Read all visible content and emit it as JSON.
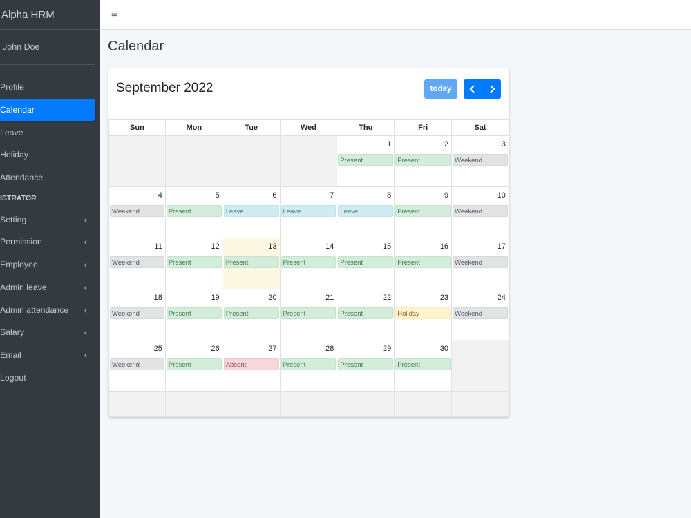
{
  "sidebar": {
    "brand": "Alpha HRM",
    "user_name": "John Doe",
    "items": [
      {
        "label": "Profile",
        "type": "item",
        "active": false,
        "arrow": false
      },
      {
        "label": "Calendar",
        "type": "item",
        "active": true,
        "arrow": false
      },
      {
        "label": "Leave",
        "type": "item",
        "active": false,
        "arrow": false
      },
      {
        "label": "Holiday",
        "type": "item",
        "active": false,
        "arrow": false
      },
      {
        "label": "Attendance",
        "type": "item",
        "active": false,
        "arrow": false
      },
      {
        "label": "ISTRATOR",
        "type": "header",
        "active": false,
        "arrow": false
      },
      {
        "label": "Setting",
        "type": "item",
        "active": false,
        "arrow": true
      },
      {
        "label": "Permission",
        "type": "item",
        "active": false,
        "arrow": true
      },
      {
        "label": "Employee",
        "type": "item",
        "active": false,
        "arrow": true
      },
      {
        "label": "Admin leave",
        "type": "item",
        "active": false,
        "arrow": true
      },
      {
        "label": "Admin attendance",
        "type": "item",
        "active": false,
        "arrow": true
      },
      {
        "label": "Salary",
        "type": "item",
        "active": false,
        "arrow": true
      },
      {
        "label": "Email",
        "type": "item",
        "active": false,
        "arrow": true
      },
      {
        "label": "Logout",
        "type": "item",
        "active": false,
        "arrow": false
      }
    ],
    "arrow_glyph": "‹"
  },
  "topbar": {
    "menu_glyph": "≡"
  },
  "page": {
    "title": "Calendar"
  },
  "calendar": {
    "title": "September 2022",
    "today_label": "today",
    "weekdays": [
      "Sun",
      "Mon",
      "Tue",
      "Wed",
      "Thu",
      "Fri",
      "Sat"
    ],
    "weeks": [
      [
        {
          "day": "",
          "other": true,
          "event": "",
          "kind": ""
        },
        {
          "day": "",
          "other": true,
          "event": "",
          "kind": ""
        },
        {
          "day": "",
          "other": true,
          "event": "",
          "kind": ""
        },
        {
          "day": "",
          "other": true,
          "event": "",
          "kind": ""
        },
        {
          "day": "1",
          "other": false,
          "event": "Present",
          "kind": "present"
        },
        {
          "day": "2",
          "other": false,
          "event": "Present",
          "kind": "present"
        },
        {
          "day": "3",
          "other": false,
          "event": "Weekend",
          "kind": "weekend"
        }
      ],
      [
        {
          "day": "4",
          "other": false,
          "event": "Weekend",
          "kind": "weekend"
        },
        {
          "day": "5",
          "other": false,
          "event": "Present",
          "kind": "present"
        },
        {
          "day": "6",
          "other": false,
          "event": "Leave",
          "kind": "leave"
        },
        {
          "day": "7",
          "other": false,
          "event": "Leave",
          "kind": "leave"
        },
        {
          "day": "8",
          "other": false,
          "event": "Leave",
          "kind": "leave"
        },
        {
          "day": "9",
          "other": false,
          "event": "Present",
          "kind": "present"
        },
        {
          "day": "10",
          "other": false,
          "event": "Weekend",
          "kind": "weekend"
        }
      ],
      [
        {
          "day": "11",
          "other": false,
          "event": "Weekend",
          "kind": "weekend"
        },
        {
          "day": "12",
          "other": false,
          "event": "Present",
          "kind": "present"
        },
        {
          "day": "13",
          "other": false,
          "today": true,
          "event": "Present",
          "kind": "present"
        },
        {
          "day": "14",
          "other": false,
          "event": "Present",
          "kind": "present"
        },
        {
          "day": "15",
          "other": false,
          "event": "Present",
          "kind": "present"
        },
        {
          "day": "16",
          "other": false,
          "event": "Present",
          "kind": "present"
        },
        {
          "day": "17",
          "other": false,
          "event": "Weekend",
          "kind": "weekend"
        }
      ],
      [
        {
          "day": "18",
          "other": false,
          "event": "Weekend",
          "kind": "weekend"
        },
        {
          "day": "19",
          "other": false,
          "event": "Present",
          "kind": "present"
        },
        {
          "day": "20",
          "other": false,
          "event": "Present",
          "kind": "present"
        },
        {
          "day": "21",
          "other": false,
          "event": "Present",
          "kind": "present"
        },
        {
          "day": "22",
          "other": false,
          "event": "Present",
          "kind": "present"
        },
        {
          "day": "23",
          "other": false,
          "event": "Holiday",
          "kind": "holiday"
        },
        {
          "day": "24",
          "other": false,
          "event": "Weekend",
          "kind": "weekend"
        }
      ],
      [
        {
          "day": "25",
          "other": false,
          "event": "Weekend",
          "kind": "weekend"
        },
        {
          "day": "26",
          "other": false,
          "event": "Present",
          "kind": "present"
        },
        {
          "day": "27",
          "other": false,
          "event": "Absent",
          "kind": "absent"
        },
        {
          "day": "28",
          "other": false,
          "event": "Present",
          "kind": "present"
        },
        {
          "day": "29",
          "other": false,
          "event": "Present",
          "kind": "present"
        },
        {
          "day": "30",
          "other": false,
          "event": "Present",
          "kind": "present"
        },
        {
          "day": "",
          "other": true,
          "event": "",
          "kind": ""
        }
      ],
      [
        {
          "day": "",
          "other": true,
          "event": "",
          "kind": ""
        },
        {
          "day": "",
          "other": true,
          "event": "",
          "kind": ""
        },
        {
          "day": "",
          "other": true,
          "event": "",
          "kind": ""
        },
        {
          "day": "",
          "other": true,
          "event": "",
          "kind": ""
        },
        {
          "day": "",
          "other": true,
          "event": "",
          "kind": ""
        },
        {
          "day": "",
          "other": true,
          "event": "",
          "kind": ""
        },
        {
          "day": "",
          "other": true,
          "event": "",
          "kind": ""
        }
      ]
    ]
  },
  "colors": {
    "sidebar_bg": "#343a40",
    "active_blue": "#007bff",
    "today_button": "#5fa8f5",
    "present": "#d4edda",
    "weekend": "#e2e3e5",
    "leave": "#d1ecf1",
    "holiday": "#fff3cd",
    "absent": "#f8d7da",
    "today_cell": "#fcf8e3"
  }
}
